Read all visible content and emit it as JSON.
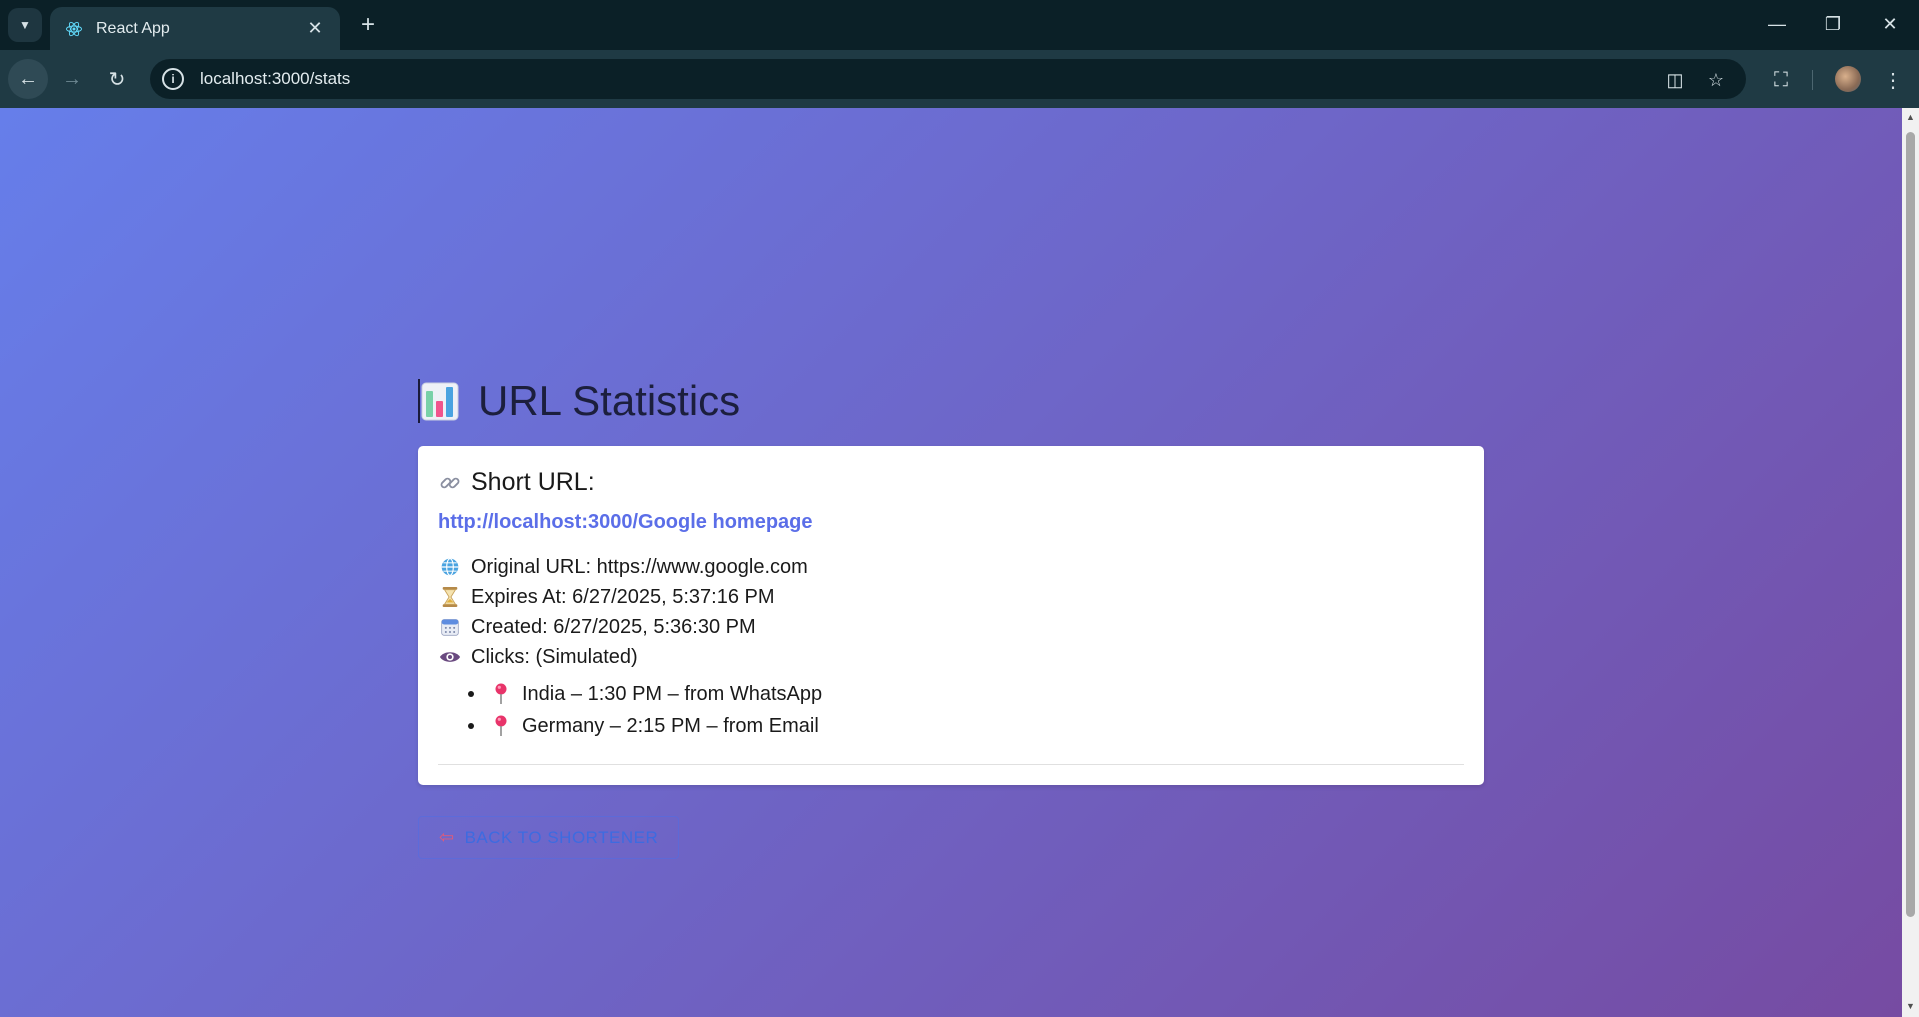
{
  "browser": {
    "tab_title": "React App",
    "url": "localhost:3000/stats"
  },
  "page": {
    "title": "URL Statistics",
    "short_url_heading": "Short URL:",
    "short_url": "http://localhost:3000/Google homepage",
    "original_url": "Original URL: https://www.google.com",
    "expires_at": "Expires At: 6/27/2025, 5:37:16 PM",
    "created": "Created: 6/27/2025, 5:36:30 PM",
    "clicks": "Clicks: (Simulated)",
    "click_entries": [
      "India – 1:30 PM – from WhatsApp",
      "Germany – 2:15 PM – from Email"
    ],
    "back_button": "BACK TO SHORTENER"
  },
  "colors": {
    "gradient_start": "#667eea",
    "gradient_end": "#764ba2",
    "link": "#5b6ee8"
  }
}
